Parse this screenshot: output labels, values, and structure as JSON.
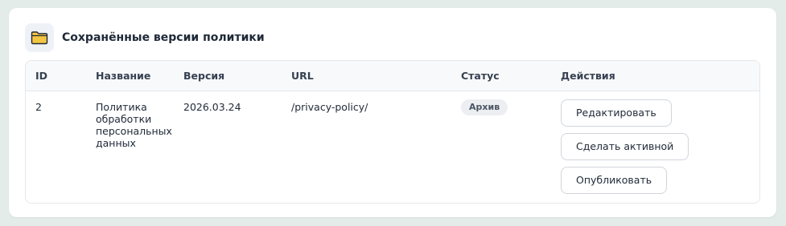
{
  "card": {
    "title": "Сохранённые версии политики",
    "icon": "folder-icon"
  },
  "table": {
    "columns": [
      "ID",
      "Название",
      "Версия",
      "URL",
      "Статус",
      "Действия"
    ],
    "rows": [
      {
        "id": "2",
        "name": "Политика обработки персональных данных",
        "version": "2026.03.24",
        "url": "/privacy-policy/",
        "status": "Архив",
        "actions": [
          "Редактировать",
          "Сделать активной",
          "Опубликовать"
        ]
      }
    ]
  },
  "colors": {
    "page_background": "#e4ecea",
    "card_background": "#ffffff",
    "badge_background": "#eceef1",
    "folder_icon": "#f4c542"
  }
}
